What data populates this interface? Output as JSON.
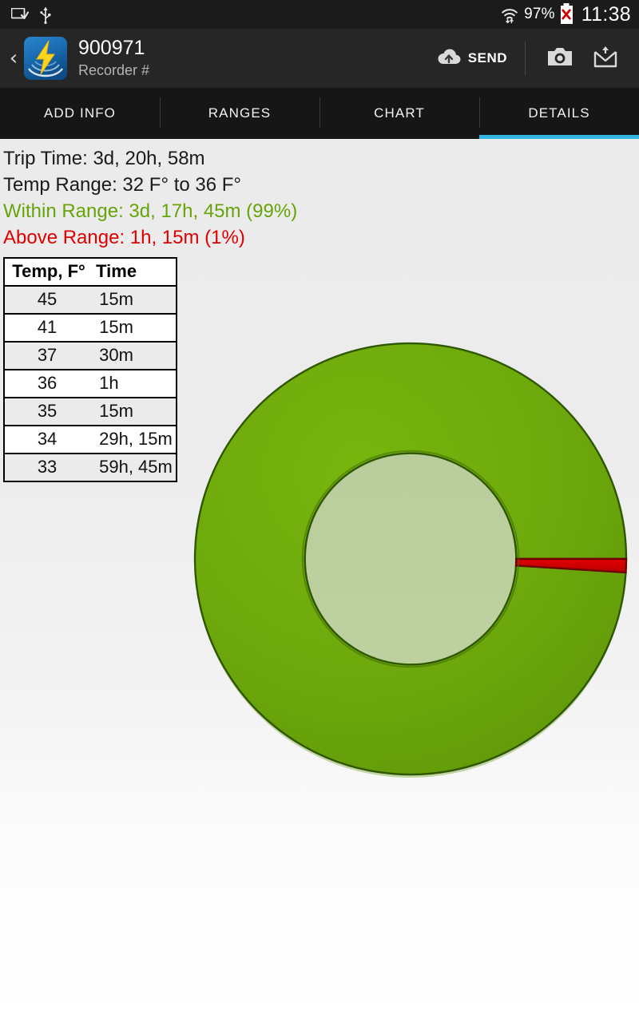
{
  "status_bar": {
    "icons": [
      "screenshot-saved-icon",
      "usb-icon",
      "wifi-icon"
    ],
    "battery_percent": "97%",
    "battery_state_icon": "battery-error-icon",
    "clock": "11:38"
  },
  "action_bar": {
    "back_icon": "back-chevron-icon",
    "app_icon": "lightning-bolt-app-icon",
    "title": "900971",
    "subtitle": "Recorder #",
    "send_label": "SEND",
    "send_icon": "cloud-upload-icon",
    "camera_icon": "camera-icon",
    "archive_icon": "inbox-upload-icon"
  },
  "tabs": [
    {
      "label": "ADD INFO",
      "active": false
    },
    {
      "label": "RANGES",
      "active": false
    },
    {
      "label": "CHART",
      "active": false
    },
    {
      "label": "DETAILS",
      "active": true
    }
  ],
  "accent_color": "#33b5e5",
  "summary": {
    "trip_time": "Trip Time: 3d, 20h, 58m",
    "temp_range": "Temp Range: 32 F° to 36 F°",
    "within_range": "Within Range: 3d, 17h, 45m (99%)",
    "above_range": "Above Range: 1h, 15m (1%)",
    "within_color": "#66a40a",
    "above_color": "#e00000"
  },
  "table": {
    "headers": [
      "Temp, F°",
      "Time"
    ],
    "rows": [
      [
        "45",
        "15m"
      ],
      [
        "41",
        "15m"
      ],
      [
        "37",
        "30m"
      ],
      [
        "36",
        "1h"
      ],
      [
        "35",
        "15m"
      ],
      [
        "34",
        "29h, 15m"
      ],
      [
        "33",
        "59h, 45m"
      ]
    ]
  },
  "chart_data": {
    "type": "pie",
    "title": "",
    "variant": "donut",
    "labels": [
      "Within Range",
      "Above Range"
    ],
    "values": [
      99,
      1
    ],
    "value_unit": "%",
    "durations": [
      "3d, 17h, 45m",
      "1h, 15m"
    ],
    "colors": [
      "#6aa50b",
      "#d40000"
    ],
    "stroke_colors": [
      "#2e5400",
      "#6e0000"
    ],
    "start_angle_deg": 0,
    "direction": "clockwise",
    "inner_radius_ratio": 0.49,
    "legend": "none",
    "grid": false
  }
}
